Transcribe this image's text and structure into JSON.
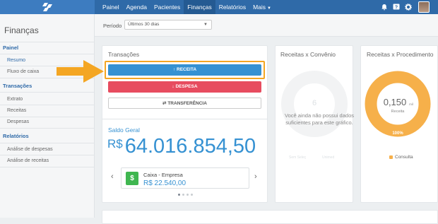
{
  "nav": {
    "items": [
      "Painel",
      "Agenda",
      "Pacientes",
      "Finanças",
      "Relatórios",
      "Mais"
    ],
    "active": "Finanças"
  },
  "sidebar": {
    "title": "Finanças",
    "sections": [
      {
        "label": "Painel",
        "items": [
          "Resumo",
          "Fluxo de caixa"
        ]
      },
      {
        "label": "Transações",
        "items": [
          "Extrato",
          "Receitas",
          "Despesas"
        ]
      },
      {
        "label": "Relatórios",
        "items": [
          "Análise de despesas",
          "Análise de receitas"
        ]
      }
    ],
    "active_item": "Resumo"
  },
  "filter": {
    "label": "Período",
    "value": "Últimos 30 dias"
  },
  "transacoes": {
    "title": "Transações",
    "receita": "RECEITA",
    "despesa": "DESPESA",
    "transferencia": "TRANSFERÊNCIA",
    "saldo_label": "Saldo Geral",
    "saldo_currency": "R$",
    "saldo_value": "64.016.854,50",
    "account_name": "Caixa - Empresa",
    "account_value": "R$ 22.540,00"
  },
  "convenio": {
    "title": "Receitas x Convênio",
    "empty_message": "Você ainda não possui dados suficientes para este gráfico.",
    "faded_value": "6",
    "faded_legend": [
      "Sem Seleç",
      "Unimed"
    ]
  },
  "procedimento": {
    "title": "Receitas x Procedimento",
    "center_value": "0,150",
    "center_unit": "mil",
    "center_label": "Receita",
    "slice_label": "100%",
    "legend": "Consulta"
  },
  "colors": {
    "nav": "#2f6aa8",
    "primary": "#3591d2",
    "danger": "#e74c5f",
    "donut": "#f6b04a",
    "highlight": "#f4a623"
  },
  "chart_data": {
    "type": "pie",
    "title": "Receitas x Procedimento",
    "categories": [
      "Consulta"
    ],
    "values": [
      100
    ],
    "center_total": "0,150 mil"
  }
}
